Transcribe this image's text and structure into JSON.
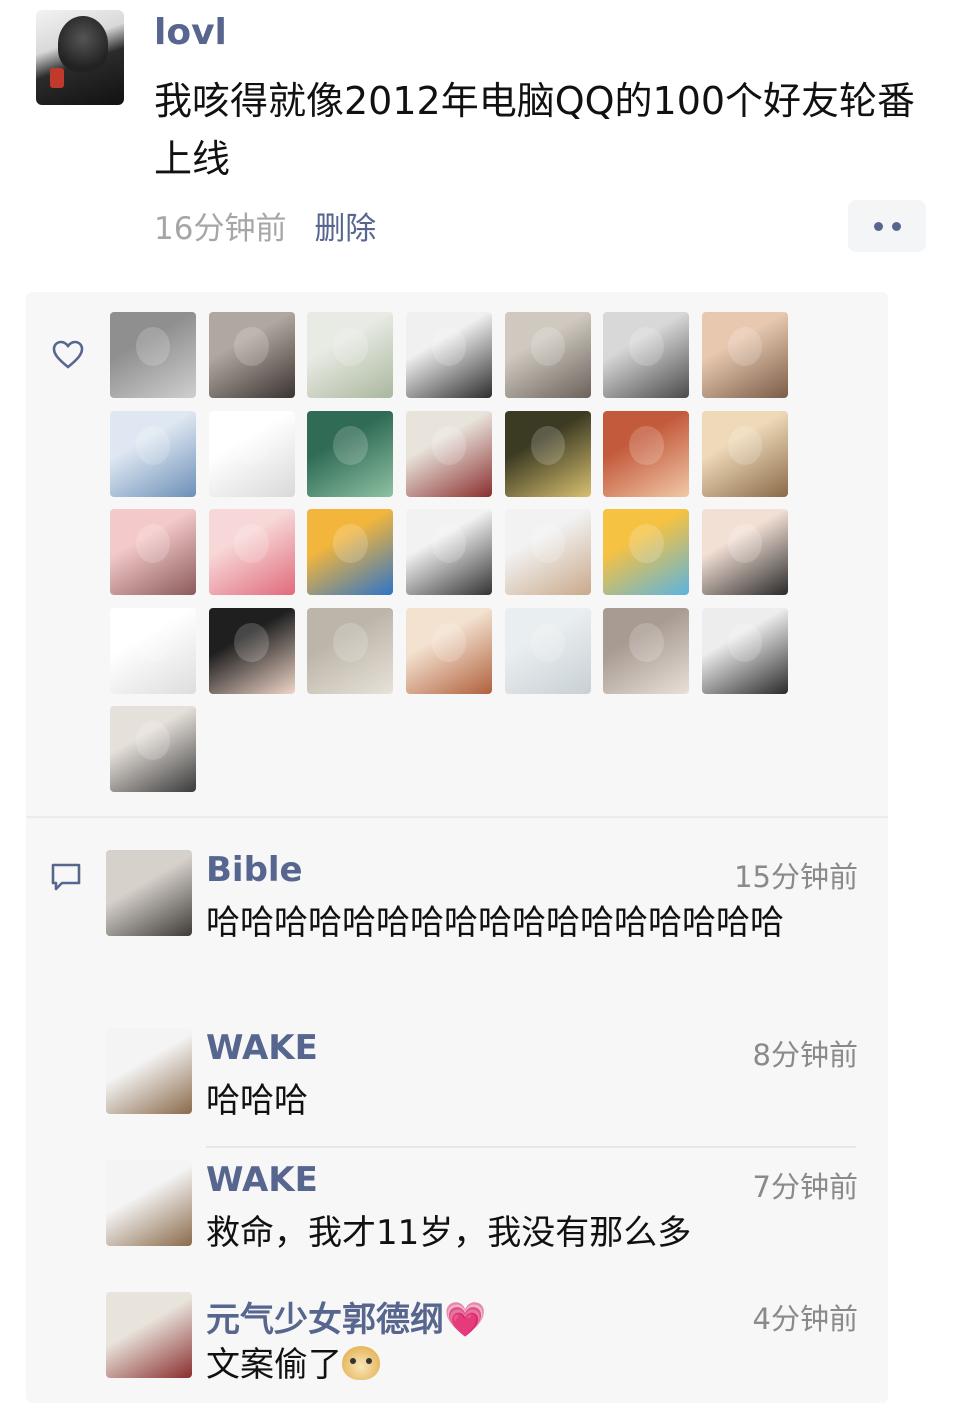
{
  "post": {
    "author": "lovl",
    "text": "我咳得就像2012年电脑QQ的100个好友轮番上线",
    "time": "16分钟前",
    "delete_label": "删除"
  },
  "icons": {
    "poster_avatar": "avatar-icon",
    "more": "more-icon",
    "like": "heart-outline-icon",
    "comment": "comment-bubble-icon"
  },
  "likes": {
    "count": 29,
    "avatar_colors": [
      [
        "#8f8f8f",
        "#cfcfcf"
      ],
      [
        "#b0a7a0",
        "#3a3330"
      ],
      [
        "#e8eae4",
        "#a9b89d"
      ],
      [
        "#f0f0f0",
        "#2d2d2d"
      ],
      [
        "#cfc9c0",
        "#6b625a"
      ],
      [
        "#d8d8d8",
        "#4a4a4a"
      ],
      [
        "#e8c9b0",
        "#7a5c48"
      ],
      [
        "#dfe8f2",
        "#6c8fb7"
      ],
      [
        "#ffffff",
        "#d9d9d9"
      ],
      [
        "#2f6b55",
        "#8fc1a3"
      ],
      [
        "#e8e4dc",
        "#8a2e2e"
      ],
      [
        "#3b3a22",
        "#d8c070"
      ],
      [
        "#c45a3c",
        "#f0c9a8"
      ],
      [
        "#eed9b8",
        "#8a6a48"
      ],
      [
        "#f4c9c9",
        "#8a5a5a"
      ],
      [
        "#f7d7d7",
        "#e06a7c"
      ],
      [
        "#f2b63c",
        "#2e74c8"
      ],
      [
        "#f2f2f2",
        "#333333"
      ],
      [
        "#f2f2f2",
        "#c9a98a"
      ],
      [
        "#f5c242",
        "#5ab4e0"
      ],
      [
        "#f3e0d5",
        "#2a2a2a"
      ],
      [
        "#ffffff",
        "#dddddd"
      ],
      [
        "#1f1f1f",
        "#f0d6c8"
      ],
      [
        "#bcb5aa",
        "#e7e2d8"
      ],
      [
        "#f3e2d0",
        "#b0603c"
      ],
      [
        "#e9eef0",
        "#c8d0d4"
      ],
      [
        "#a89b92",
        "#e8e0d8"
      ],
      [
        "#ededed",
        "#2a2a2a"
      ],
      [
        "#e6e0da",
        "#3a3a3a"
      ]
    ]
  },
  "comments": [
    {
      "name": "Bible",
      "time": "15分钟前",
      "text": "哈哈哈哈哈哈哈哈哈哈哈哈哈哈哈哈哈",
      "avatar": [
        "#d6d1cb",
        "#3e3a36"
      ]
    },
    {
      "name": "WAKE",
      "time": "8分钟前",
      "text": "哈哈哈",
      "avatar": [
        "#f4f4f4",
        "#8a6a4a"
      ]
    },
    {
      "name": "WAKE",
      "time": "7分钟前",
      "text": "救命，我才11岁，我没有那么多",
      "avatar": [
        "#f4f4f4",
        "#8a6a4a"
      ]
    },
    {
      "name": "元气少女郭德纲",
      "name_emoji": "💗",
      "time": "4分钟前",
      "text": "文案偷了",
      "text_emoji": "doge-icon",
      "avatar": [
        "#e8e4dc",
        "#8a2e2e"
      ]
    }
  ]
}
